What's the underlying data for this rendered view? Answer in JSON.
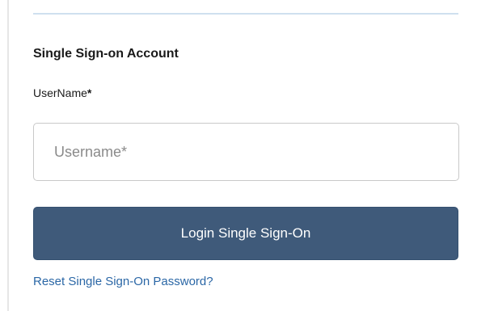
{
  "form": {
    "title": "Single Sign-on Account",
    "username_label": "UserName",
    "required_mark": "*",
    "username_placeholder": "Username*",
    "username_value": "",
    "login_button_label": "Login Single Sign-On",
    "reset_link_label": "Reset Single Sign-On Password?"
  },
  "colors": {
    "button_background": "#3f5a7a",
    "link": "#2b67a6",
    "divider": "#cfe0ef"
  }
}
